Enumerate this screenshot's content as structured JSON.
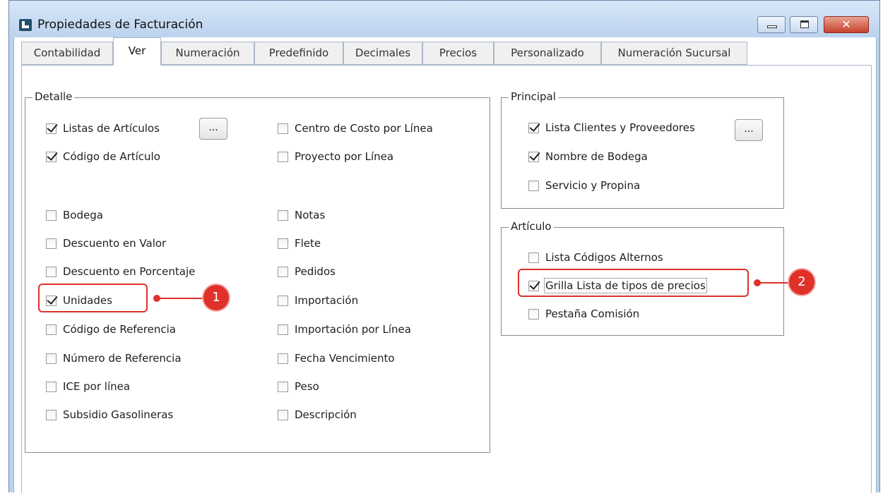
{
  "window": {
    "title": "Propiedades de Facturación",
    "close_label": "✕"
  },
  "tabs": [
    "Contabilidad",
    "Ver",
    "Numeración",
    "Predefinido",
    "Decimales",
    "Precios",
    "Personalizado",
    "Numeración Sucursal"
  ],
  "active_tab": "Ver",
  "detalle": {
    "legend": "Detalle",
    "ellipsis_label": "...",
    "col1": [
      {
        "label": "Listas de Artículos",
        "checked": true
      },
      {
        "label": "Código de Artículo",
        "checked": true
      },
      {
        "label": "Bodega",
        "checked": false
      },
      {
        "label": "Descuento en Valor",
        "checked": false
      },
      {
        "label": "Descuento en Porcentaje",
        "checked": false
      },
      {
        "label": "Unidades",
        "checked": true
      },
      {
        "label": "Código de Referencia",
        "checked": false
      },
      {
        "label": "Número de Referencia",
        "checked": false
      },
      {
        "label": "ICE por línea",
        "checked": false
      },
      {
        "label": "Subsidio Gasolineras",
        "checked": false
      }
    ],
    "col2": [
      {
        "label": "Centro de Costo por Línea",
        "checked": false
      },
      {
        "label": "Proyecto por Línea",
        "checked": false
      },
      {
        "label": "Notas",
        "checked": false
      },
      {
        "label": "Flete",
        "checked": false
      },
      {
        "label": "Pedidos",
        "checked": false
      },
      {
        "label": "Importación",
        "checked": false
      },
      {
        "label": "Importación por Línea",
        "checked": false
      },
      {
        "label": "Fecha Vencimiento",
        "checked": false
      },
      {
        "label": "Peso",
        "checked": false
      },
      {
        "label": "Descripción",
        "checked": false
      }
    ]
  },
  "principal": {
    "legend": "Principal",
    "ellipsis_label": "...",
    "items": [
      {
        "label": "Lista Clientes y Proveedores",
        "checked": true
      },
      {
        "label": "Nombre de Bodega",
        "checked": true
      },
      {
        "label": "Servicio y Propina",
        "checked": false
      }
    ]
  },
  "articulo": {
    "legend": "Artículo",
    "items": [
      {
        "label": "Lista Códigos Alternos",
        "checked": false
      },
      {
        "label": "Grilla Lista de tipos de precios",
        "checked": true
      },
      {
        "label": "Pestaña Comisión",
        "checked": false
      }
    ]
  },
  "annotations": {
    "badge1": "1",
    "badge2": "2",
    "color": "#e0302a"
  }
}
